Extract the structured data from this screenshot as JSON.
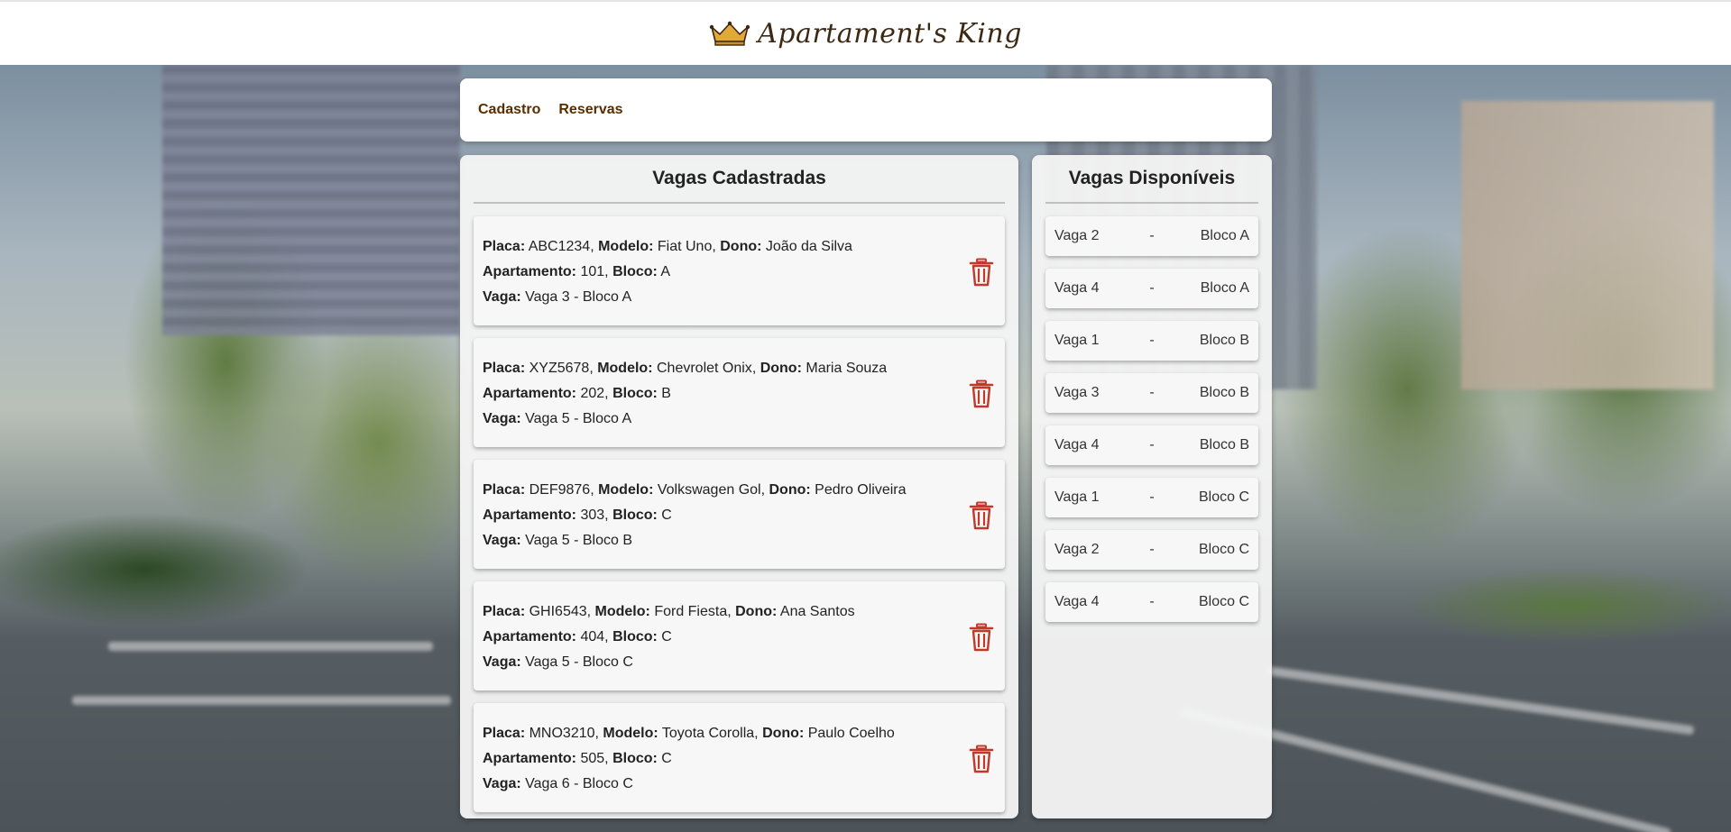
{
  "brand": {
    "name": "Apartament's King",
    "icon": "crown-icon",
    "color": "#3d2813"
  },
  "nav": {
    "items": [
      {
        "label": "Cadastro"
      },
      {
        "label": "Reservas"
      }
    ]
  },
  "registered": {
    "title": "Vagas Cadastradas",
    "labels": {
      "placa": "Placa:",
      "modelo": "Modelo:",
      "dono": "Dono:",
      "apartamento": "Apartamento:",
      "bloco": "Bloco:",
      "vaga": "Vaga:"
    },
    "items": [
      {
        "placa": "ABC1234",
        "modelo": "Fiat Uno",
        "dono": "João da Silva",
        "apartamento": "101",
        "bloco": "A",
        "vaga": "Vaga 3 - Bloco A"
      },
      {
        "placa": "XYZ5678",
        "modelo": "Chevrolet Onix",
        "dono": "Maria Souza",
        "apartamento": "202",
        "bloco": "B",
        "vaga": "Vaga 5 - Bloco A"
      },
      {
        "placa": "DEF9876",
        "modelo": "Volkswagen Gol",
        "dono": "Pedro Oliveira",
        "apartamento": "303",
        "bloco": "C",
        "vaga": "Vaga 5 - Bloco B"
      },
      {
        "placa": "GHI6543",
        "modelo": "Ford Fiesta",
        "dono": "Ana Santos",
        "apartamento": "404",
        "bloco": "C",
        "vaga": "Vaga 5 - Bloco C"
      },
      {
        "placa": "MNO3210",
        "modelo": "Toyota Corolla",
        "dono": "Paulo Coelho",
        "apartamento": "505",
        "bloco": "C",
        "vaga": "Vaga 6 - Bloco C"
      }
    ],
    "delete_icon": "trash-icon",
    "delete_color": "#c0392b"
  },
  "available": {
    "title": "Vagas Disponíveis",
    "separator": "-",
    "items": [
      {
        "vaga": "Vaga 2",
        "bloco": "Bloco A"
      },
      {
        "vaga": "Vaga 4",
        "bloco": "Bloco A"
      },
      {
        "vaga": "Vaga 1",
        "bloco": "Bloco B"
      },
      {
        "vaga": "Vaga 3",
        "bloco": "Bloco B"
      },
      {
        "vaga": "Vaga 4",
        "bloco": "Bloco B"
      },
      {
        "vaga": "Vaga 1",
        "bloco": "Bloco C"
      },
      {
        "vaga": "Vaga 2",
        "bloco": "Bloco C"
      },
      {
        "vaga": "Vaga 4",
        "bloco": "Bloco C"
      }
    ]
  }
}
